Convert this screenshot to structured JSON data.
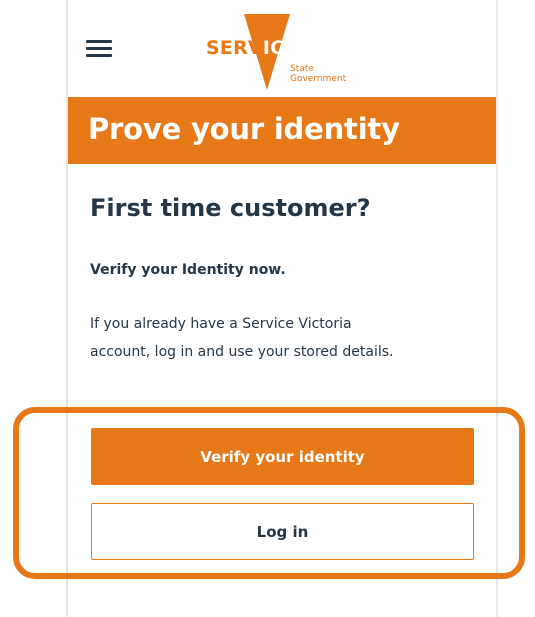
{
  "header": {
    "logo": {
      "word_main": "SERV",
      "word_accent": "ICE",
      "sub_line1": "State",
      "sub_line2": "Government",
      "icon": "victoria-triangle-logo"
    },
    "menu_icon": "hamburger-menu-icon"
  },
  "banner": {
    "title": "Prove your identity"
  },
  "content": {
    "subheading": "First time customer?",
    "lead": "Verify your Identity now.",
    "body_line1": "If you already have a Service Victoria",
    "body_line2": "account, log in and use your stored details."
  },
  "actions": {
    "verify_label": "Verify your identity",
    "login_label": "Log in"
  },
  "colors": {
    "brand_orange": "#e67817",
    "text_navy": "#253746",
    "white": "#ffffff"
  }
}
